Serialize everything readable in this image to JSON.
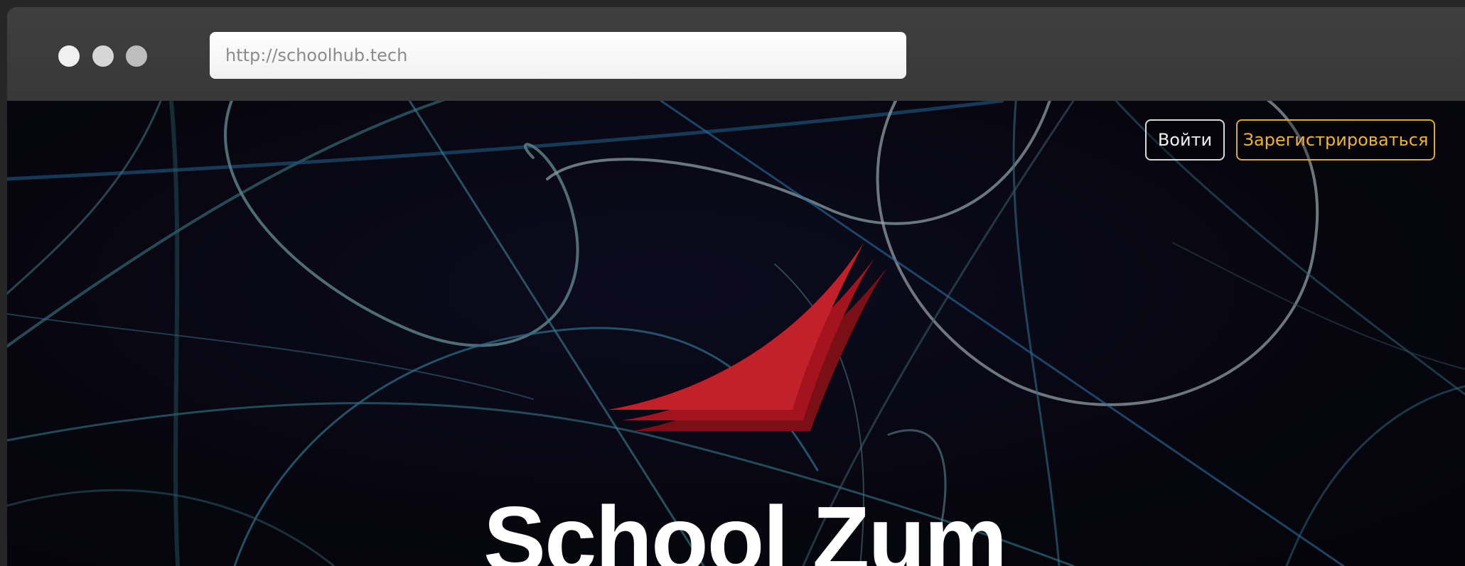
{
  "browser": {
    "url": "http://schoolhub.tech"
  },
  "header": {
    "login_label": "Войти",
    "register_label": "Зарегистрироваться"
  },
  "hero": {
    "title": "School Zum"
  },
  "colors": {
    "login_border": "#d9d9d9",
    "register_accent": "#f0b13f",
    "logo_red": "#c1212b",
    "background": "#07060f"
  }
}
